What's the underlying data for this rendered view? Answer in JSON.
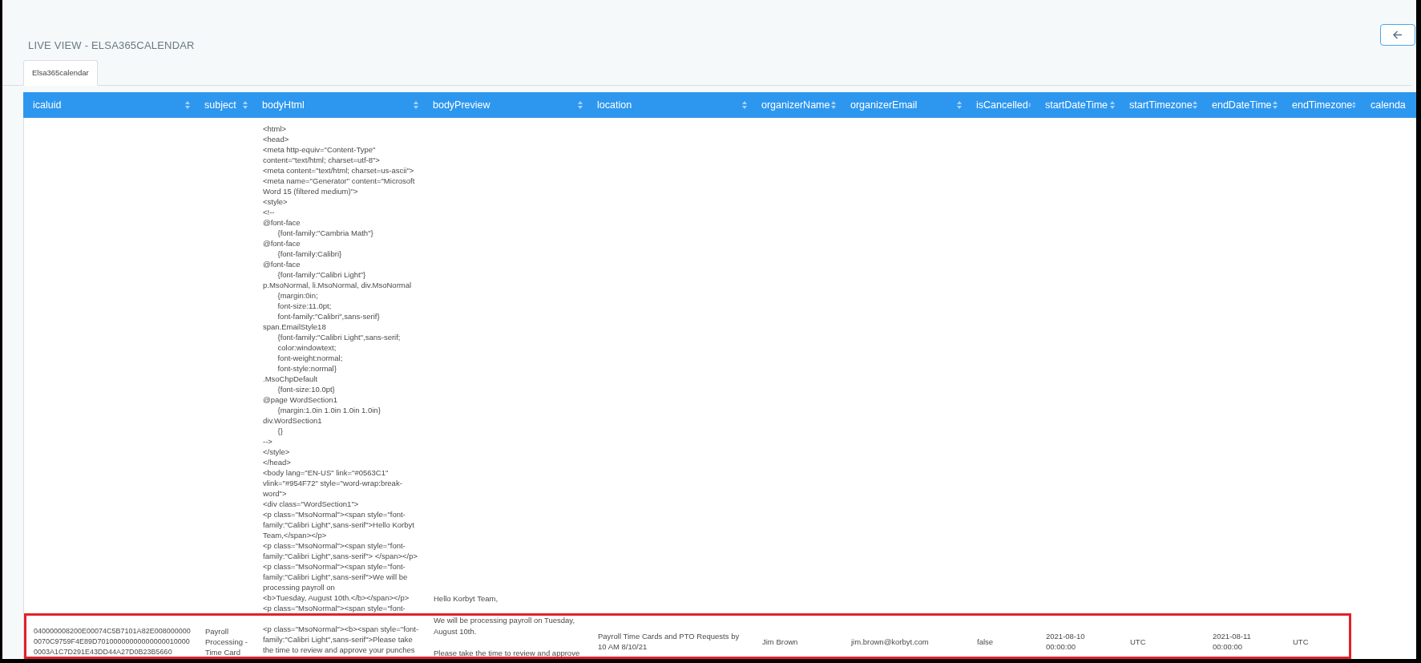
{
  "page_title": "LIVE VIEW - ELSA365CALENDAR",
  "back_button": {
    "kind": "back"
  },
  "tabs": [
    {
      "label": "Elsa365calendar",
      "selected": true
    }
  ],
  "table": {
    "columns": [
      {
        "label": "icaluid"
      },
      {
        "label": "subject"
      },
      {
        "label": "bodyHtml"
      },
      {
        "label": "bodyPreview"
      },
      {
        "label": "location"
      },
      {
        "label": "organizerName"
      },
      {
        "label": "organizerEmail"
      },
      {
        "label": "isCancelled"
      },
      {
        "label": "startDateTime"
      },
      {
        "label": "startTimezone"
      },
      {
        "label": "endDateTime"
      },
      {
        "label": "endTimezone"
      },
      {
        "label": "calenda"
      }
    ],
    "rows": [
      {
        "highlighted": true,
        "cells": [
          {
            "kind": "text",
            "text": "040000008200E00074C5B7101A82E0080000000070C9759F4E89D701000000000000000100000003A1C7D291E43DD44A27D0B23B5660"
          },
          {
            "kind": "text",
            "text": "Payroll Processing - Time Card"
          },
          {
            "kind": "code",
            "lines": [
              {
                "text": "<html>"
              },
              {
                "text": "<head>"
              },
              {
                "text": "<meta http-equiv=\"Content-Type\""
              },
              {
                "text": "content=\"text/html; charset=utf-8\">"
              },
              {
                "text": "<meta content=\"text/html; charset=us-ascii\">"
              },
              {
                "text": "<meta name=\"Generator\" content=\"Microsoft"
              },
              {
                "text": "Word 15 (filtered medium)\">"
              },
              {
                "text": "<style>"
              },
              {
                "text": "<!--"
              },
              {
                "text": "@font-face"
              },
              {
                "text": "\t{font-family:\"Cambria Math\"}"
              },
              {
                "text": "@font-face"
              },
              {
                "text": "\t{font-family:Calibri}"
              },
              {
                "text": "@font-face"
              },
              {
                "text": "\t{font-family:\"Calibri Light\"}"
              },
              {
                "text": "p.MsoNormal, li.MsoNormal, div.MsoNormal"
              },
              {
                "text": "\t{margin:0in;"
              },
              {
                "text": "\tfont-size:11.0pt;"
              },
              {
                "text": "\tfont-family:\"Calibri\",sans-serif}"
              },
              {
                "text": "span.EmailStyle18"
              },
              {
                "text": "\t{font-family:\"Calibri Light\",sans-serif;"
              },
              {
                "text": "\tcolor:windowtext;"
              },
              {
                "text": "\tfont-weight:normal;"
              },
              {
                "text": "\tfont-style:normal}"
              },
              {
                "text": ".MsoChpDefault"
              },
              {
                "text": "\t{font-size:10.0pt}"
              },
              {
                "text": "@page WordSection1"
              },
              {
                "text": "\t{margin:1.0in 1.0in 1.0in 1.0in}"
              },
              {
                "text": "div.WordSection1"
              },
              {
                "text": "\t{}"
              },
              {
                "text": "-->"
              },
              {
                "text": "</style>"
              },
              {
                "text": "</head>"
              },
              {
                "text": "<body lang=\"EN-US\" link=\"#0563C1\""
              },
              {
                "text": "vlink=\"#954F72\" style=\"word-wrap:break-"
              },
              {
                "text": "word\">"
              },
              {
                "text": "<div class=\"WordSection1\">"
              },
              {
                "text": "<p class=\"MsoNormal\"><span style=\"font-"
              },
              {
                "text": "family:\"Calibri Light\",sans-serif\">Hello Korbyt"
              },
              {
                "text": "Team,</span></p>"
              },
              {
                "text": "<p class=\"MsoNormal\"><span style=\"font-"
              },
              {
                "text": "family:\"Calibri Light\",sans-serif\"> </span></p>"
              },
              {
                "text": "<p class=\"MsoNormal\"><span style=\"font-"
              },
              {
                "text": "family:\"Calibri Light\",sans-serif\">We will be"
              },
              {
                "text": "processing payroll on"
              },
              {
                "text": "<b>Tuesday, August 10th.</b></span></p>"
              },
              {
                "text": "<p class=\"MsoNormal\"><span style=\"font-"
              },
              {
                "text": "<p class=\"MsoNormal\"><b><span style=\"font-",
                "gap_before": true
              },
              {
                "text": "family:\"Calibri Light\",sans-serif\">Please take"
              },
              {
                "text": "the time to review and approve your punches"
              }
            ]
          },
          {
            "kind": "paragraphs",
            "paragraphs": [
              "Hello Korbyt Team,",
              "We will be processing payroll on Tuesday, August 10th.",
              "Please take the time to review and approve"
            ]
          },
          {
            "kind": "text",
            "text": "Payroll Time Cards and PTO Requests by 10 AM 8/10/21"
          },
          {
            "kind": "text",
            "text": "Jim Brown"
          },
          {
            "kind": "text",
            "text": "jim.brown@korbyt.com"
          },
          {
            "kind": "text",
            "text": "false"
          },
          {
            "kind": "text",
            "text": "2021-08-10 00:00:00"
          },
          {
            "kind": "text",
            "text": "UTC"
          },
          {
            "kind": "text",
            "text": "2021-08-11 00:00:00"
          },
          {
            "kind": "text",
            "text": "UTC"
          },
          {
            "kind": "empty"
          }
        ]
      }
    ]
  }
}
